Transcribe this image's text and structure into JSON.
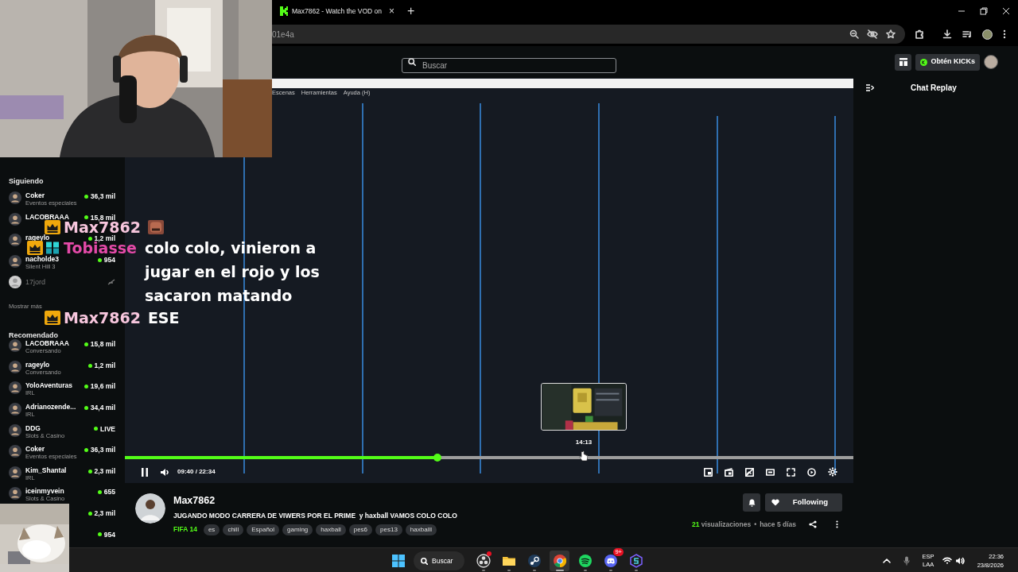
{
  "browser": {
    "tab": {
      "title": "Max7862 - Watch the VOD on ",
      "close": "×"
    },
    "new_tab": "+",
    "address": "01e4a"
  },
  "header": {
    "search": {
      "placeholder": "Buscar"
    },
    "kicks_button": "Obtén KICKs"
  },
  "sidebar": {
    "sections": [
      {
        "title": "Siguiendo",
        "items": [
          {
            "name": "Coker",
            "category": "Eventos especiales",
            "viewers": "36,3 mil",
            "live": true
          },
          {
            "name": "LACOBRAAA",
            "viewers": "15,8 mil",
            "live": true
          },
          {
            "name": "rageylo",
            "viewers": "1,2 mil",
            "live": true
          },
          {
            "name": "nacholde3",
            "category": "Silent Hill 3",
            "viewers": "954",
            "live": true
          },
          {
            "name": "17jord",
            "live": false
          }
        ],
        "more": "Mostrar más"
      },
      {
        "title": "Recomendado",
        "items": [
          {
            "name": "LACOBRAAA",
            "category": "Conversando",
            "viewers": "15,8 mil",
            "live": true
          },
          {
            "name": "rageylo",
            "category": "Conversando",
            "viewers": "1,2 mil",
            "live": true
          },
          {
            "name": "YoloAventuras",
            "category": "IRL",
            "viewers": "19,6 mil",
            "live": true
          },
          {
            "name": "Adrianozende...",
            "category": "IRL",
            "viewers": "34,4 mil",
            "live": true
          },
          {
            "name": "DDG",
            "category": "Slots & Casino",
            "viewers": "LIVE",
            "live": true
          },
          {
            "name": "Coker",
            "category": "Eventos especiales",
            "viewers": "36,3 mil",
            "live": true
          },
          {
            "name": "Kim_Shantal",
            "category": "IRL",
            "viewers": "2,3 mil",
            "live": true
          },
          {
            "name": "iceinmyvein",
            "category": "Slots & Casino",
            "viewers": "655",
            "live": true
          },
          {
            "viewers": "2,3 mil",
            "live": true
          },
          {
            "viewers": "954",
            "live": true
          }
        ]
      }
    ]
  },
  "video": {
    "menu": [
      "Escenas",
      "Herramientas",
      "Ayuda (H)"
    ],
    "preview": {
      "kind": "picture",
      "time": "14:13"
    },
    "progress": {
      "level": 0.429
    },
    "time": "09:40 / 22:34"
  },
  "chat_overlay": [
    {
      "badges": [
        {
          "kind": "crown"
        }
      ],
      "username": "Max7862",
      "color": "#f7c6dd",
      "emote": true
    },
    {
      "badges": [
        {
          "kind": "crown"
        },
        {
          "kind": "og"
        }
      ],
      "username": "Tobiasse",
      "color": "#e44aa8",
      "text": "colo colo, vinieron a jugar en el rojo y los sacaron matando",
      "emote": false
    },
    {
      "badges": [
        {
          "kind": "crown"
        }
      ],
      "username": "Max7862",
      "color": "#f7c6dd",
      "text": "ESE",
      "emote": false
    }
  ],
  "channel": {
    "name": "Max7862",
    "title": "JUGANDO MODO CARRERA DE VIWERS POR EL PRIME  y haxball VAMOS COLO COLO",
    "category": "FIFA 14",
    "tags": [
      "es",
      "chill",
      "Español",
      "gaming",
      "haxball",
      "pes6",
      "pes13",
      "haxballl"
    ],
    "follow_label": "Following",
    "views": "21",
    "views_label": "visualizaciones",
    "separator": "•",
    "age": "hace 5 días"
  },
  "chat_panel": {
    "title": "Chat Replay"
  },
  "taskbar": {
    "search": "Buscar",
    "apps": [
      {
        "kind": "obs",
        "dot": true,
        "selected": false
      },
      {
        "kind": "files",
        "dot": false,
        "selected": false
      },
      {
        "kind": "steam",
        "dot": false,
        "selected": false
      },
      {
        "kind": "chrome",
        "dot": false,
        "selected": true
      },
      {
        "kind": "spotify",
        "dot": false,
        "selected": false
      },
      {
        "kind": "discord",
        "dot": false,
        "badge": "9+",
        "selected": false
      },
      {
        "kind": "shield",
        "dot": false,
        "selected": false
      }
    ],
    "language": [
      "ESP",
      "LAA"
    ],
    "time": "22:36",
    "date": "23/8/2026"
  }
}
